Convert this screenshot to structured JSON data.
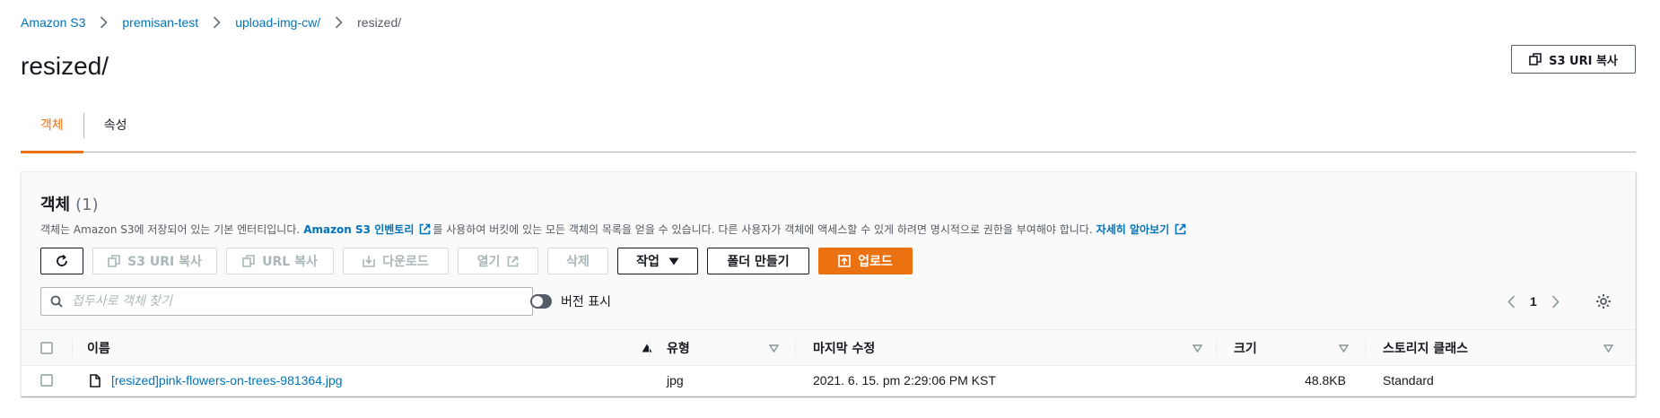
{
  "breadcrumb": {
    "items": [
      "Amazon S3",
      "premisan-test",
      "upload-img-cw/"
    ],
    "current": "resized/"
  },
  "page": {
    "title": "resized/",
    "copy_uri_label": "S3 URI 복사"
  },
  "tabs": [
    {
      "label": "객체",
      "active": true
    },
    {
      "label": "속성",
      "active": false
    }
  ],
  "objects_panel": {
    "title": "객체",
    "count": "(1)",
    "description_prefix": "객체는 Amazon S3에 저장되어 있는 기본 엔터티입니다.",
    "inventory_link": "Amazon S3 인벤토리",
    "description_middle": "를 사용하여 버킷에 있는 모든 객체의 목록을 얻을 수 있습니다. 다른 사용자가 객체에 액세스할 수 있게 하려면 명시적으로 권한을 부여해야 합니다.",
    "learn_more_link": "자세히 알아보기",
    "actions": {
      "copy_s3_uri": "S3 URI 복사",
      "copy_url": "URL 복사",
      "download": "다운로드",
      "open": "열기",
      "delete": "삭제",
      "actions": "작업",
      "create_folder": "폴더 만들기",
      "upload": "업로드"
    },
    "search_placeholder": "접두사로 객체 찾기",
    "show_versions_label": "버전 표시",
    "page_number": "1"
  },
  "table": {
    "columns": [
      "이름",
      "유형",
      "마지막 수정",
      "크기",
      "스토리지 클래스"
    ],
    "rows": [
      {
        "name": "[resized]pink-flowers-on-trees-981364.jpg",
        "type": "jpg",
        "last_modified": "2021. 6. 15. pm 2:29:06 PM KST",
        "size": "48.8KB",
        "storage_class": "Standard"
      }
    ]
  },
  "colors": {
    "accent": "#ec7211",
    "link": "#0073bb",
    "text": "#16191f",
    "muted": "#545b64"
  }
}
